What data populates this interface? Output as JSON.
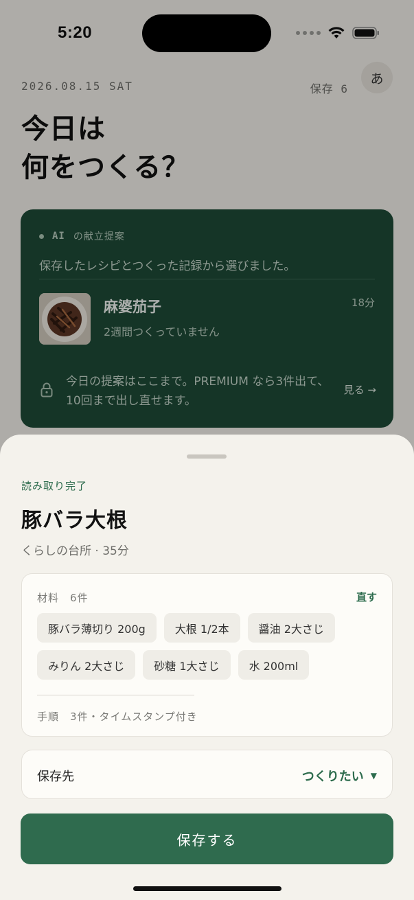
{
  "status_bar": {
    "time": "5:20"
  },
  "header": {
    "date": "2026.08.15 SAT",
    "saved_count": "保存 6",
    "avatar_initial": "あ",
    "headline_line1": "今日は",
    "headline_line2": "何をつくる？"
  },
  "ai_card": {
    "label_mono": "AI",
    "label_text": "の献立提案",
    "description": "保存したレシピとつくった記録から選びました。",
    "recipe": {
      "name": "麻婆茄子",
      "subtitle": "2週間つくっていません",
      "time": "18分"
    },
    "premium_text": "今日の提案はここまで。PREMIUM なら3件出て、10回まで出し直せます。",
    "see_more": "見る →"
  },
  "sheet": {
    "status": "読み取り完了",
    "title": "豚バラ大根",
    "subtitle": "くらしの台所 · 35分",
    "ingredients": {
      "heading": "材料　6件",
      "fix_label": "直す",
      "items": [
        "豚バラ薄切り 200g",
        "大根 1/2本",
        "醤油 2大さじ",
        "みりん 2大さじ",
        "砂糖 1大さじ",
        "水 200ml"
      ],
      "steps_info": "手順　3件・タイムスタンプ付き"
    },
    "destination": {
      "label": "保存先",
      "value": "つくりたい"
    },
    "save_button": "保存する"
  },
  "colors": {
    "accent_green": "#2f6b4e",
    "card_dark_green": "#1e4a36",
    "background": "#f1efe9"
  }
}
